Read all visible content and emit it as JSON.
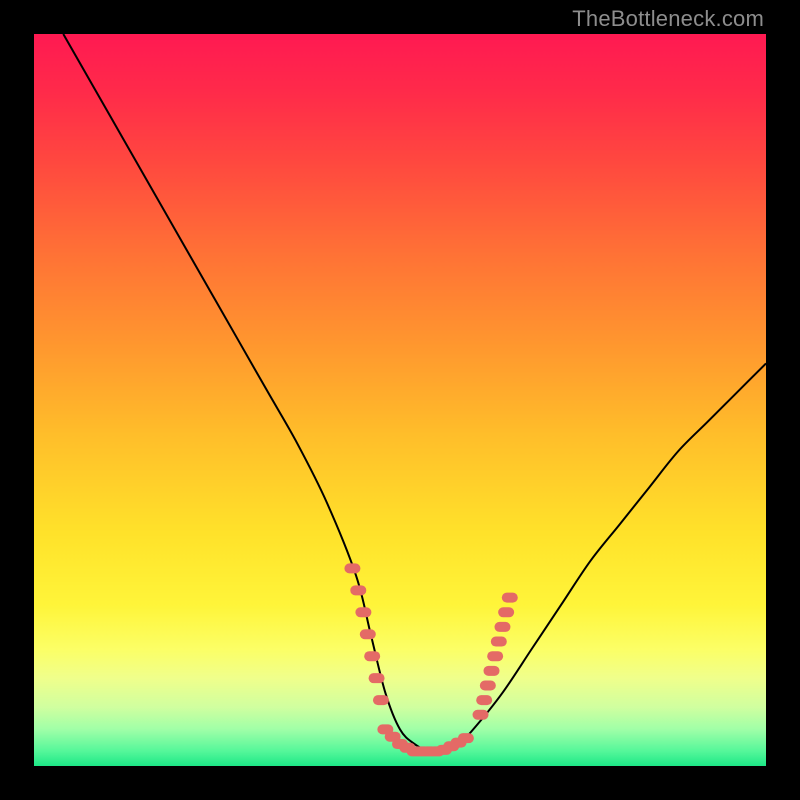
{
  "watermark": "TheBottleneck.com",
  "gradient": {
    "stops": [
      {
        "offset": 0.0,
        "color": "#ff1a52"
      },
      {
        "offset": 0.08,
        "color": "#ff2b4a"
      },
      {
        "offset": 0.18,
        "color": "#ff4a3f"
      },
      {
        "offset": 0.3,
        "color": "#ff7236"
      },
      {
        "offset": 0.42,
        "color": "#ff962f"
      },
      {
        "offset": 0.55,
        "color": "#ffbf2a"
      },
      {
        "offset": 0.68,
        "color": "#ffe22a"
      },
      {
        "offset": 0.78,
        "color": "#fff53a"
      },
      {
        "offset": 0.84,
        "color": "#fcff66"
      },
      {
        "offset": 0.88,
        "color": "#f0ff8c"
      },
      {
        "offset": 0.92,
        "color": "#d0ffa0"
      },
      {
        "offset": 0.95,
        "color": "#a0ffa8"
      },
      {
        "offset": 0.98,
        "color": "#55f79a"
      },
      {
        "offset": 1.0,
        "color": "#1de887"
      }
    ]
  },
  "chart_data": {
    "type": "line",
    "title": "",
    "xlabel": "",
    "ylabel": "",
    "xlim": [
      0,
      100
    ],
    "ylim": [
      0,
      100
    ],
    "series": [
      {
        "name": "bottleneck-curve",
        "x": [
          4,
          8,
          12,
          16,
          20,
          24,
          28,
          32,
          36,
          40,
          44,
          46,
          48,
          50,
          52,
          54,
          56,
          58,
          60,
          64,
          68,
          72,
          76,
          80,
          84,
          88,
          92,
          96,
          100
        ],
        "y": [
          100,
          93,
          86,
          79,
          72,
          65,
          58,
          51,
          44,
          36,
          26,
          18,
          10,
          5,
          3,
          2,
          2,
          3,
          5,
          10,
          16,
          22,
          28,
          33,
          38,
          43,
          47,
          51,
          55
        ]
      }
    ],
    "marker_clusters": [
      {
        "name": "left-cluster",
        "color": "#e46a66",
        "points": [
          {
            "x": 43.5,
            "y": 27
          },
          {
            "x": 44.3,
            "y": 24
          },
          {
            "x": 45.0,
            "y": 21
          },
          {
            "x": 45.6,
            "y": 18
          },
          {
            "x": 46.2,
            "y": 15
          },
          {
            "x": 46.8,
            "y": 12
          },
          {
            "x": 47.4,
            "y": 9
          }
        ]
      },
      {
        "name": "bottom-cluster",
        "color": "#e46a66",
        "points": [
          {
            "x": 48,
            "y": 5
          },
          {
            "x": 49,
            "y": 4
          },
          {
            "x": 50,
            "y": 3
          },
          {
            "x": 51,
            "y": 2.5
          },
          {
            "x": 52,
            "y": 2
          },
          {
            "x": 53,
            "y": 2
          },
          {
            "x": 54,
            "y": 2
          },
          {
            "x": 55,
            "y": 2
          },
          {
            "x": 56,
            "y": 2.2
          },
          {
            "x": 57,
            "y": 2.7
          },
          {
            "x": 58,
            "y": 3.2
          },
          {
            "x": 59,
            "y": 3.8
          }
        ]
      },
      {
        "name": "right-cluster",
        "color": "#e46a66",
        "points": [
          {
            "x": 61.0,
            "y": 7
          },
          {
            "x": 61.5,
            "y": 9
          },
          {
            "x": 62.0,
            "y": 11
          },
          {
            "x": 62.5,
            "y": 13
          },
          {
            "x": 63.0,
            "y": 15
          },
          {
            "x": 63.5,
            "y": 17
          },
          {
            "x": 64.0,
            "y": 19
          },
          {
            "x": 64.5,
            "y": 21
          },
          {
            "x": 65.0,
            "y": 23
          }
        ]
      }
    ]
  }
}
